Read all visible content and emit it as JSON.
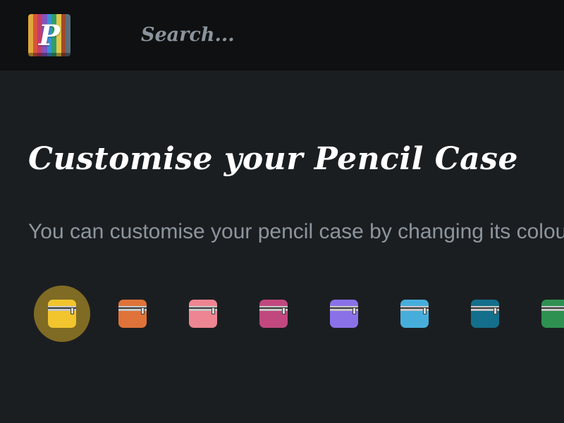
{
  "header": {
    "logo_letter": "P",
    "logo_stripes": [
      "#e0a83a",
      "#d9533b",
      "#c43c6a",
      "#7b56c2",
      "#3b8fd1",
      "#2e9e6f",
      "#e3c547",
      "#a04a2a",
      "#5b6e7a"
    ],
    "search_placeholder": "Search..."
  },
  "main": {
    "title": "Customise your Pencil Case",
    "description": "You can customise your pencil case by changing its colour."
  },
  "colour_options": [
    {
      "name": "yellow",
      "color": "#f2c52e",
      "selected": true
    },
    {
      "name": "orange",
      "color": "#df7339",
      "selected": false
    },
    {
      "name": "pink",
      "color": "#ee8592",
      "selected": false
    },
    {
      "name": "magenta",
      "color": "#c0487f",
      "selected": false
    },
    {
      "name": "purple",
      "color": "#8a71e8",
      "selected": false
    },
    {
      "name": "light-blue",
      "color": "#47aedc",
      "selected": false
    },
    {
      "name": "teal",
      "color": "#146f8c",
      "selected": false
    },
    {
      "name": "green",
      "color": "#2f9151",
      "selected": false
    }
  ]
}
